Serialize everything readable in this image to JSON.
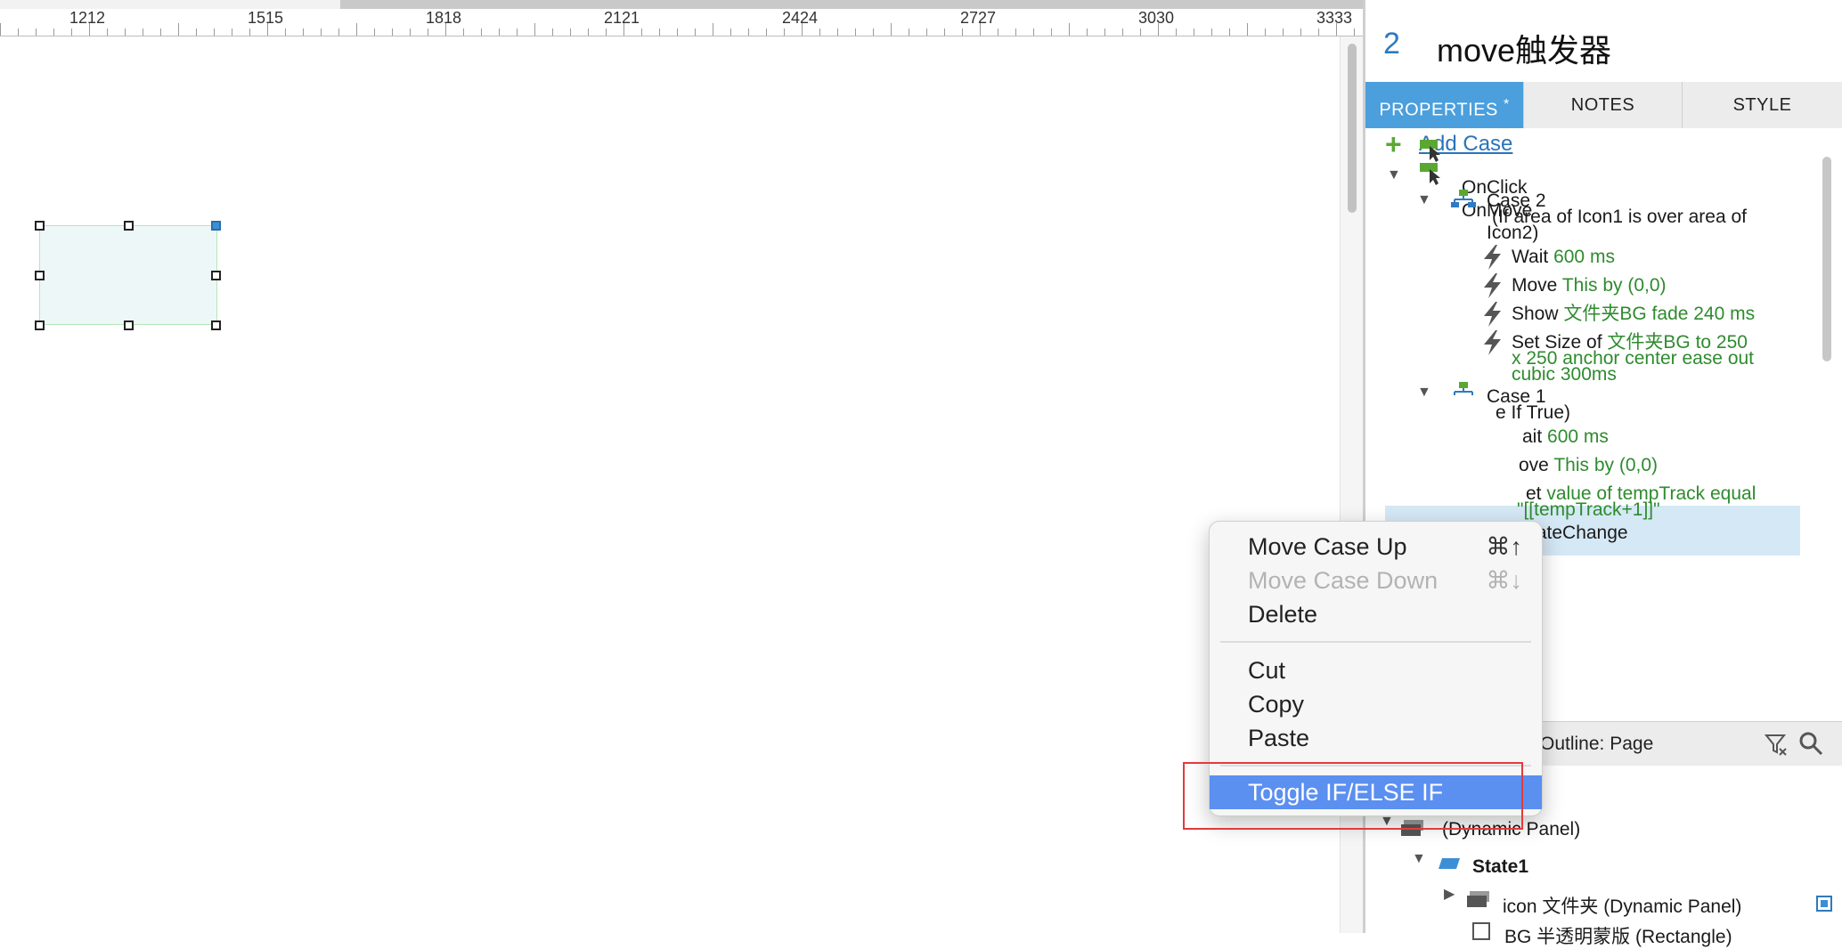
{
  "ruler": {
    "labels": [
      "1212",
      "1515",
      "1818",
      "2121",
      "2424",
      "2727",
      "3030",
      "3333"
    ]
  },
  "panel": {
    "number": "2",
    "title": "move触发器",
    "tabs": {
      "properties": "PROPERTIES",
      "properties_mark": "*",
      "notes": "NOTES",
      "style": "STYLE"
    },
    "add_case": "Add Case",
    "events": {
      "onclick": "OnClick",
      "onmove": "OnMove"
    },
    "case2": {
      "title": "Case 2",
      "cond1": "(If area of Icon1 is over area of",
      "cond2": "Icon2)",
      "actions": [
        {
          "verb": "Wait",
          "detail": "600 ms"
        },
        {
          "verb": "Move",
          "detail": "This by (0,0)"
        },
        {
          "verb": "Show",
          "detail": "文件夹BG fade 240 ms"
        },
        {
          "verb": "Set Size of",
          "detail": "文件夹BG to 250",
          "detail2": "x 250 anchor center ease out",
          "detail3": "cubic 300ms"
        }
      ]
    },
    "case1": {
      "title": "Case 1",
      "cond": "e If True)",
      "actions": [
        {
          "verb": "ait",
          "detail": "600 ms"
        },
        {
          "verb": "ove",
          "detail": "This by (0,0)"
        },
        {
          "verb": "et",
          "detail": "value of tempTrack equal",
          "detail2": "\"[[tempTrack+1]]\""
        },
        {
          "verb": "StateChange"
        }
      ]
    },
    "outline": {
      "title": "Outline: Page",
      "items": {
        "dynamic_panel": "(Dynamic Panel)",
        "state1": "State1",
        "icon_folder": "icon 文件夹 (Dynamic Panel)",
        "bg_rect": "BG 半透明蒙版 (Rectangle)"
      }
    }
  },
  "context_menu": {
    "move_up": {
      "label": "Move Case Up",
      "shortcut": "⌘↑"
    },
    "move_down": {
      "label": "Move Case Down",
      "shortcut": "⌘↓"
    },
    "delete": "Delete",
    "cut": "Cut",
    "copy": "Copy",
    "paste": "Paste",
    "toggle": "Toggle IF/ELSE IF"
  },
  "colors": {
    "accent": "#4a9fdc",
    "menu_highlight": "#5b8ff0",
    "action_green": "#2e8b2e",
    "annotation_red": "#e23b3b"
  }
}
